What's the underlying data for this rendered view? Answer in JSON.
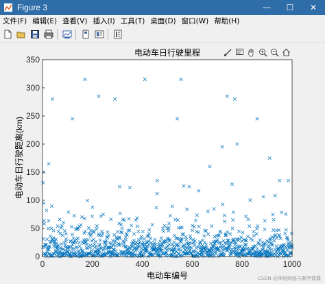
{
  "window": {
    "title": "Figure 3",
    "minimize": "—",
    "maximize": "☐",
    "close": "✕"
  },
  "menu": [
    "文件(F)",
    "编辑(E)",
    "查看(V)",
    "插入(I)",
    "工具(T)",
    "桌面(D)",
    "窗口(W)",
    "帮助(H)"
  ],
  "toolbar": {
    "buttons": [
      {
        "name": "new-figure-icon"
      },
      {
        "name": "open-file-icon"
      },
      {
        "name": "save-icon"
      },
      {
        "name": "print-icon"
      },
      {
        "name": "link-plot-icon"
      },
      {
        "name": "data-cursor-icon"
      },
      {
        "name": "insert-colorbar-icon"
      },
      {
        "name": "insert-legend-icon"
      }
    ]
  },
  "axes_toolbar": [
    "brush-icon",
    "data-tip-icon",
    "pan-icon",
    "zoom-in-icon",
    "zoom-out-icon",
    "home-icon"
  ],
  "watermark": "CSDN @神经网络与数学建模",
  "colors": {
    "marker": "#0072bd",
    "titlebar": "#2f6da8"
  },
  "chart_data": {
    "type": "scatter",
    "title": "电动车日行驶里程",
    "xlabel": "电动车编号",
    "ylabel": "电动车日行驶距离(km)",
    "xlim": [
      0,
      1000
    ],
    "ylim": [
      0,
      350
    ],
    "xticks": [
      0,
      200,
      400,
      600,
      800,
      1000
    ],
    "yticks": [
      0,
      50,
      100,
      150,
      200,
      250,
      300,
      350
    ],
    "marker": "x",
    "grid": false,
    "notable_points": {
      "x": [
        5,
        25,
        40,
        170,
        225,
        290,
        410,
        555,
        740,
        770,
        120,
        540,
        910,
        780,
        720,
        860,
        670,
        950,
        985,
        460
      ],
      "y": [
        150,
        165,
        280,
        315,
        285,
        280,
        315,
        315,
        285,
        280,
        245,
        245,
        175,
        200,
        195,
        245,
        160,
        135,
        135,
        135
      ]
    },
    "bulk_distribution": {
      "count": 1000,
      "typical_range": [
        0,
        70
      ],
      "mode_near": 15
    }
  }
}
